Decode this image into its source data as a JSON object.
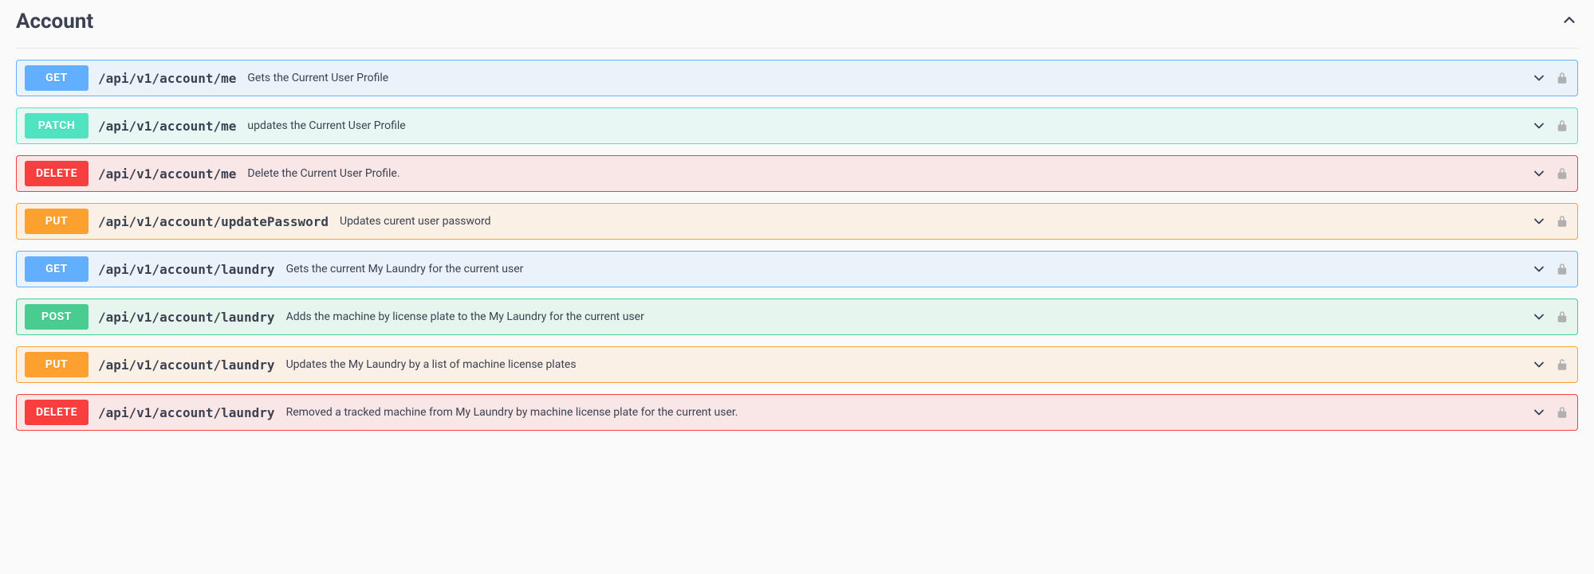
{
  "section": {
    "title": "Account",
    "expanded": true
  },
  "operations": [
    {
      "method": "GET",
      "path": "/api/v1/account/me",
      "desc": "Gets the Current User Profile",
      "locked": true
    },
    {
      "method": "PATCH",
      "path": "/api/v1/account/me",
      "desc": "updates the Current User Profile",
      "locked": true
    },
    {
      "method": "DELETE",
      "path": "/api/v1/account/me",
      "desc": "Delete the Current User Profile.",
      "locked": true
    },
    {
      "method": "PUT",
      "path": "/api/v1/account/updatePassword",
      "desc": "Updates curent user password",
      "locked": true
    },
    {
      "method": "GET",
      "path": "/api/v1/account/laundry",
      "desc": "Gets the current My Laundry for the current user",
      "locked": true
    },
    {
      "method": "POST",
      "path": "/api/v1/account/laundry",
      "desc": "Adds the machine by license plate to the My Laundry for the current user",
      "locked": true
    },
    {
      "method": "PUT",
      "path": "/api/v1/account/laundry",
      "desc": "Updates the My Laundry by a list of machine license plates",
      "locked": false
    },
    {
      "method": "DELETE",
      "path": "/api/v1/account/laundry",
      "desc": "Removed a tracked machine from My Laundry by machine license plate for the current user.",
      "locked": true
    }
  ]
}
